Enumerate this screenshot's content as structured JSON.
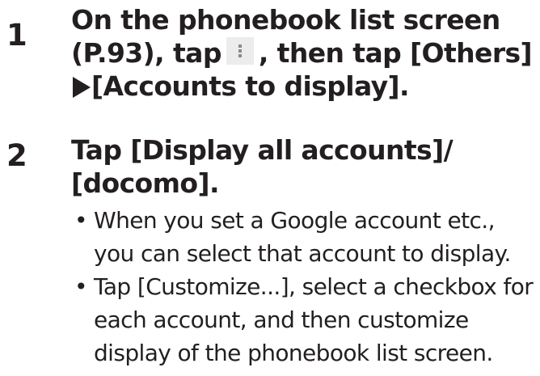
{
  "steps": [
    {
      "number": "1",
      "text_before_icon": "On the phonebook list screen (P.93), tap",
      "icon": "menu-overflow-icon",
      "text_after_icon": ", then tap [Others]",
      "arrow": "right-triangle-icon",
      "text_after_arrow": "[Accounts to display]."
    },
    {
      "number": "2",
      "text": "Tap [Display all accounts]/ [docomo].",
      "bullets": [
        "When you set a Google account etc., you can select that account to display.",
        "Tap [Customize...], select a checkbox for each account, and then customize display of the phonebook list screen."
      ]
    }
  ],
  "bullet_marker": "•"
}
